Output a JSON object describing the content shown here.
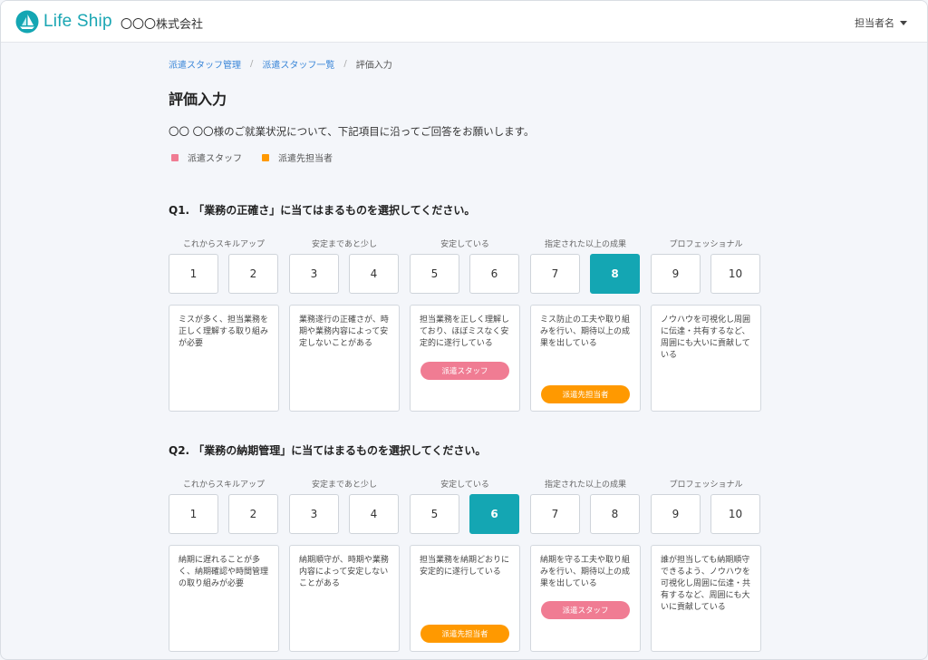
{
  "app": {
    "logo_text": "Life Ship",
    "company": "〇〇〇株式会社",
    "user_name": "担当者名"
  },
  "colors": {
    "brand": "#14a6b3",
    "staff": "#f07c93",
    "client": "#ff9900",
    "link": "#3a86d8"
  },
  "breadcrumb": {
    "item1": "派遣スタッフ管理",
    "item2": "派遣スタッフ一覧",
    "current": "評価入力",
    "separator": "/"
  },
  "page": {
    "title": "評価入力",
    "intro": "〇〇 〇〇様のご就業状況について、下記項目に沿ってご回答をお願いします。"
  },
  "legend": {
    "staff": "派遣スタッフ",
    "client": "派遣先担当者"
  },
  "questions": [
    {
      "title": "Q1. 「業務の正確さ」に当てはまるものを選択してください。",
      "selected": "8",
      "groups": [
        {
          "label": "これからスキルアップ",
          "scores": [
            "1",
            "2"
          ],
          "desc": "ミスが多く、担当業務を正しく理解する取り組みが必要",
          "badge": ""
        },
        {
          "label": "安定まであと少し",
          "scores": [
            "3",
            "4"
          ],
          "desc": "業務遂行の正確さが、時期や業務内容によって安定しないことがある",
          "badge": ""
        },
        {
          "label": "安定している",
          "scores": [
            "5",
            "6"
          ],
          "desc": "担当業務を正しく理解しており、ほぼミスなく安定的に遂行している",
          "badge": "派遣スタッフ"
        },
        {
          "label": "指定された以上の成果",
          "scores": [
            "7",
            "8"
          ],
          "desc": "ミス防止の工夫や取り組みを行い、期待以上の成果を出している",
          "badge": "派遣先担当者"
        },
        {
          "label": "プロフェッショナル",
          "scores": [
            "9",
            "10"
          ],
          "desc": "ノウハウを可視化し周囲に伝達・共有するなど、周囲にも大いに貢献している",
          "badge": ""
        }
      ]
    },
    {
      "title": "Q2. 「業務の納期管理」に当てはまるものを選択してください。",
      "selected": "6",
      "groups": [
        {
          "label": "これからスキルアップ",
          "scores": [
            "1",
            "2"
          ],
          "desc": "納期に遅れることが多く、納期確認や時間管理の取り組みが必要",
          "badge": ""
        },
        {
          "label": "安定まであと少し",
          "scores": [
            "3",
            "4"
          ],
          "desc": "納期順守が、時期や業務内容によって安定しないことがある",
          "badge": ""
        },
        {
          "label": "安定している",
          "scores": [
            "5",
            "6"
          ],
          "desc": "担当業務を納期どおりに安定的に遂行している",
          "badge": "派遣先担当者"
        },
        {
          "label": "指定された以上の成果",
          "scores": [
            "7",
            "8"
          ],
          "desc": "納期を守る工夫や取り組みを行い、期待以上の成果を出している",
          "badge": "派遣スタッフ"
        },
        {
          "label": "プロフェッショナル",
          "scores": [
            "9",
            "10"
          ],
          "desc": "誰が担当しても納期順守できるよう、ノウハウを可視化し周囲に伝達・共有するなど、周囲にも大いに貢献している",
          "badge": ""
        }
      ]
    }
  ]
}
